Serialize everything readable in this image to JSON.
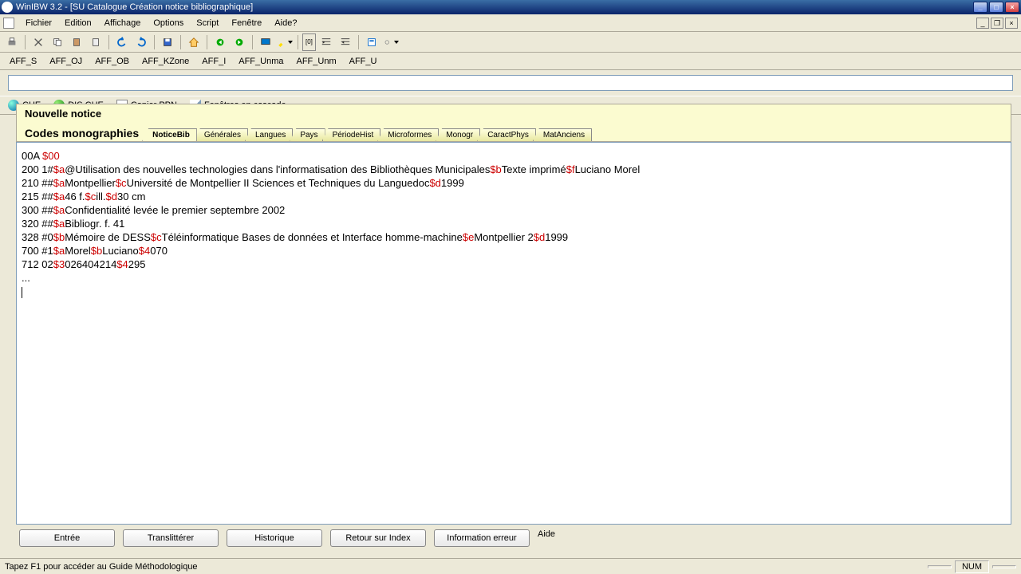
{
  "window": {
    "title": "WinIBW 3.2 - [SU Catalogue Création notice bibliographique]"
  },
  "menu": {
    "items": [
      "Fichier",
      "Edition",
      "Affichage",
      "Options",
      "Script",
      "Fenêtre",
      "Aide?"
    ]
  },
  "aff_toolbar": {
    "items": [
      "AFF_S",
      "AFF_OJ",
      "AFF_OB",
      "AFF_KZone",
      "AFF_I",
      "AFF_Unma",
      "AFF_Unm",
      "AFF_U"
    ]
  },
  "action_toolbar": {
    "che": "CHE",
    "dis_che": "DIS CHE",
    "copier_ppn": "Copier PPN",
    "fenetres": "Fenêtres en cascade"
  },
  "notice": {
    "title": "Nouvelle notice",
    "section": "Codes monographies",
    "tabs": [
      "NoticeBib",
      "Générales",
      "Langues",
      "Pays",
      "PériodeHist",
      "Microformes",
      "Monogr",
      "CaractPhys",
      "MatAnciens"
    ]
  },
  "record": {
    "lines": [
      [
        {
          "t": "00A ",
          "s": 0
        },
        {
          "t": "$00",
          "s": 1
        }
      ],
      [
        {
          "t": "200 1#",
          "s": 0
        },
        {
          "t": "$a",
          "s": 1
        },
        {
          "t": "@Utilisation des nouvelles technologies dans l'informatisation des Bibliothèques Municipales",
          "s": 0
        },
        {
          "t": "$b",
          "s": 1
        },
        {
          "t": "Texte imprimé",
          "s": 0
        },
        {
          "t": "$f",
          "s": 1
        },
        {
          "t": "Luciano Morel",
          "s": 0
        }
      ],
      [
        {
          "t": "210 ##",
          "s": 0
        },
        {
          "t": "$a",
          "s": 1
        },
        {
          "t": "Montpellier",
          "s": 0
        },
        {
          "t": "$c",
          "s": 1
        },
        {
          "t": "Université de Montpellier II Sciences et Techniques du Languedoc",
          "s": 0
        },
        {
          "t": "$d",
          "s": 1
        },
        {
          "t": "1999",
          "s": 0
        }
      ],
      [
        {
          "t": "215 ##",
          "s": 0
        },
        {
          "t": "$a",
          "s": 1
        },
        {
          "t": "46 f.",
          "s": 0
        },
        {
          "t": "$c",
          "s": 1
        },
        {
          "t": "ill.",
          "s": 0
        },
        {
          "t": "$d",
          "s": 1
        },
        {
          "t": "30 cm",
          "s": 0
        }
      ],
      [
        {
          "t": "300 ##",
          "s": 0
        },
        {
          "t": "$a",
          "s": 1
        },
        {
          "t": "Confidentialité levée le premier septembre 2002",
          "s": 0
        }
      ],
      [
        {
          "t": "320 ##",
          "s": 0
        },
        {
          "t": "$a",
          "s": 1
        },
        {
          "t": "Bibliogr. f. 41",
          "s": 0
        }
      ],
      [
        {
          "t": "328 #0",
          "s": 0
        },
        {
          "t": "$b",
          "s": 1
        },
        {
          "t": "Mémoire de DESS",
          "s": 0
        },
        {
          "t": "$c",
          "s": 1
        },
        {
          "t": "Téléinformatique Bases de données et Interface homme-machine",
          "s": 0
        },
        {
          "t": "$e",
          "s": 1
        },
        {
          "t": "Montpellier 2",
          "s": 0
        },
        {
          "t": "$d",
          "s": 1
        },
        {
          "t": "1999",
          "s": 0
        }
      ],
      [
        {
          "t": "700 #1",
          "s": 0
        },
        {
          "t": "$a",
          "s": 1
        },
        {
          "t": "Morel",
          "s": 0
        },
        {
          "t": "$b",
          "s": 1
        },
        {
          "t": "Luciano",
          "s": 0
        },
        {
          "t": "$4",
          "s": 1
        },
        {
          "t": "070",
          "s": 0
        }
      ],
      [
        {
          "t": "712 02",
          "s": 0
        },
        {
          "t": "$3",
          "s": 1
        },
        {
          "t": "026404214",
          "s": 0
        },
        {
          "t": "$4",
          "s": 1
        },
        {
          "t": "295",
          "s": 0
        }
      ]
    ],
    "tail": "..."
  },
  "bottom_buttons": [
    "Entrée",
    "Translittérer",
    "Historique",
    "Retour sur Index",
    "Information erreur",
    "Aide"
  ],
  "status": {
    "hint": "Tapez F1 pour accéder au Guide Méthodologique",
    "num": "NUM"
  },
  "toolbar_text": {
    "ioi": "[0]"
  }
}
